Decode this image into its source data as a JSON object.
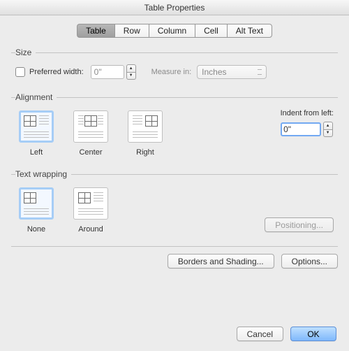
{
  "title": "Table Properties",
  "tabs": [
    "Table",
    "Row",
    "Column",
    "Cell",
    "Alt Text"
  ],
  "size": {
    "legend": "Size",
    "preferred_width_label": "Preferred width:",
    "preferred_width_value": "0\"",
    "measure_in_label": "Measure in:",
    "measure_in_value": "Inches"
  },
  "alignment": {
    "legend": "Alignment",
    "left": "Left",
    "center": "Center",
    "right": "Right",
    "indent_label": "Indent from left:",
    "indent_value": "0\""
  },
  "wrapping": {
    "legend": "Text wrapping",
    "none": "None",
    "around": "Around",
    "positioning_btn": "Positioning..."
  },
  "borders_btn": "Borders and Shading...",
  "options_btn": "Options...",
  "cancel_btn": "Cancel",
  "ok_btn": "OK"
}
